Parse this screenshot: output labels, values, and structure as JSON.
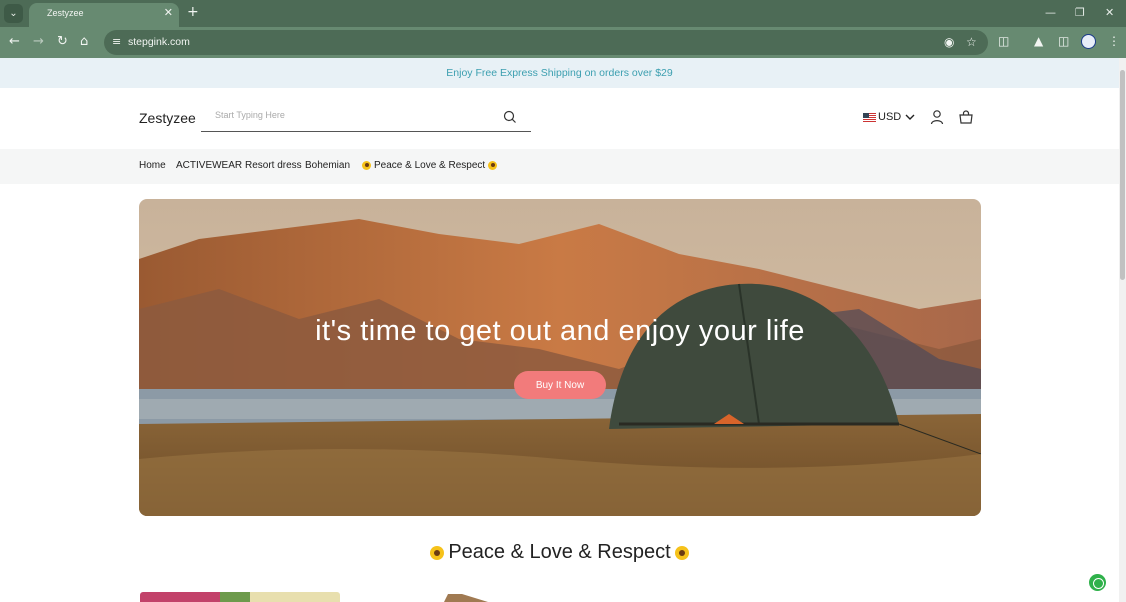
{
  "browser": {
    "tab_title": "Zestyzee",
    "url": "stepgink.com"
  },
  "announcement": "Enjoy Free Express Shipping on orders over $29",
  "header": {
    "logo": "Zestyzee",
    "search_placeholder": "Start Typing Here",
    "currency": "USD"
  },
  "menu": {
    "items": [
      "Home",
      "ACTIVEWEAR",
      "Resort dress",
      "Bohemian",
      "Peace & Love & Respect"
    ]
  },
  "hero": {
    "title": "it's time to get out and enjoy your life",
    "button_label": "Buy It Now"
  },
  "section": {
    "title": "Peace & Love & Respect"
  },
  "colors": {
    "announcement_text": "#3c9fb0",
    "announcement_bg": "#e8f1f6",
    "hero_button": "#f27b7b",
    "browser_frame": "#4d6b56"
  },
  "icons": [
    "search-icon",
    "user-icon",
    "cart-icon",
    "chevron-down-icon",
    "sunflower-icon",
    "chat-icon"
  ]
}
